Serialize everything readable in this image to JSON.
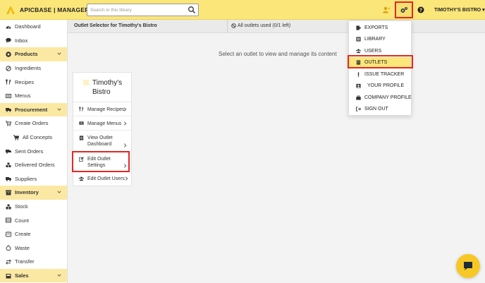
{
  "topbar": {
    "brand": "APICBASE | MANAGER",
    "search_placeholder": "Search in this library",
    "account": "TIMOTHY'S BISTRO ▾"
  },
  "sidebar": {
    "items": [
      {
        "label": "Dashboard",
        "icon": "dashboard-icon"
      },
      {
        "label": "Inbox",
        "icon": "inbox-icon"
      },
      {
        "label": "Products",
        "icon": "products-icon",
        "section": true
      },
      {
        "label": "Ingredients",
        "icon": "ingredients-icon"
      },
      {
        "label": "Recipes",
        "icon": "recipes-icon"
      },
      {
        "label": "Menus",
        "icon": "menus-icon"
      },
      {
        "label": "Procurement",
        "icon": "procurement-icon",
        "section": true
      },
      {
        "label": "Create Orders",
        "icon": "cart-icon"
      },
      {
        "label": "All Concepts",
        "icon": "cart-icon",
        "sub": true
      },
      {
        "label": "Sent Orders",
        "icon": "sent-orders-icon"
      },
      {
        "label": "Delivered Orders",
        "icon": "delivered-icon"
      },
      {
        "label": "Suppliers",
        "icon": "truck-icon"
      },
      {
        "label": "Inventory",
        "icon": "inventory-icon",
        "section": true
      },
      {
        "label": "Stock",
        "icon": "stock-icon"
      },
      {
        "label": "Count",
        "icon": "count-icon"
      },
      {
        "label": "Create",
        "icon": "create-icon"
      },
      {
        "label": "Waste",
        "icon": "waste-icon"
      },
      {
        "label": "Transfer",
        "icon": "transfer-icon"
      },
      {
        "label": "Sales",
        "icon": "sales-icon",
        "section": true
      }
    ]
  },
  "content": {
    "title": "Outlet Selector for Timothy's Bistro",
    "status": "All outlets used (0/1 left)",
    "hint": "Select an outlet to view and manage its content"
  },
  "outlet_card": {
    "name": "Timothy's Bistro",
    "actions": [
      {
        "label": "Manage Recipes",
        "icon": "recipes-icon"
      },
      {
        "label": "Manage Menus",
        "icon": "menus-icon"
      },
      {
        "label": "View Outlet Dashboard",
        "icon": "dashboard-doc-icon"
      },
      {
        "label": "Edit Outlet Settings",
        "icon": "edit-icon"
      },
      {
        "label": "Edit Outlet Users",
        "icon": "users-icon"
      }
    ]
  },
  "settings_menu": {
    "items": [
      {
        "label": "EXPORTS",
        "icon": "export-icon"
      },
      {
        "label": "LIBRARY",
        "icon": "library-icon"
      },
      {
        "label": "USERS",
        "icon": "users-icon"
      },
      {
        "label": "OUTLETS",
        "icon": "outlets-icon",
        "active": true
      },
      {
        "label": "ISSUE TRACKER",
        "icon": "exclamation-icon"
      },
      {
        "label": "YOUR PROFILE",
        "icon": "profile-icon"
      },
      {
        "label": "COMPANY PROFILE",
        "icon": "briefcase-icon"
      },
      {
        "label": "SIGN OUT",
        "icon": "sign-out-icon"
      }
    ]
  },
  "colors": {
    "brand_yellow": "#fbe67a",
    "section_yellow": "#fbe9a3",
    "highlight_red": "#e42822",
    "chat_yellow": "#f7c825"
  }
}
